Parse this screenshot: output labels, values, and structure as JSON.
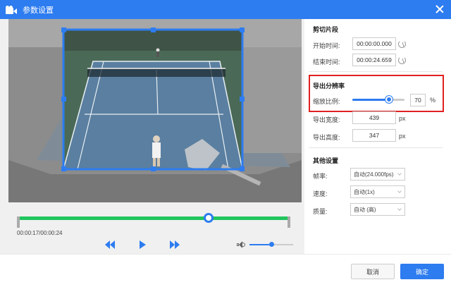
{
  "window": {
    "title": "参数设置"
  },
  "playback": {
    "current_time": "00:00:17/00:00:24",
    "progress": 0.7,
    "volume": 0.5
  },
  "trim": {
    "section_title": "剪切片段",
    "start_label": "开始时间:",
    "start_value": "00:00:00.000",
    "end_label": "结束时间:",
    "end_value": "00:00:24.659"
  },
  "resolution": {
    "section_title": "导出分辨率",
    "scale_label": "缩放比例:",
    "scale_value": "70",
    "scale_unit": "%",
    "scale_fraction": 0.7,
    "width_label": "导出宽度:",
    "width_value": "439",
    "height_label": "导出高度:",
    "height_value": "347",
    "unit_px": "px"
  },
  "other": {
    "section_title": "其他设置",
    "framerate_label": "帧率:",
    "framerate_value": "自动(24.000fps)",
    "speed_label": "速度:",
    "speed_value": "自动(1x)",
    "quality_label": "质量:",
    "quality_value": "自动 (高)"
  },
  "footer": {
    "cancel_label": "取消",
    "ok_label": "确定"
  },
  "colors": {
    "accent": "#2d7cf0",
    "progress": "#22c55e",
    "highlight": "#e02020",
    "court": "#5a7fa0"
  }
}
